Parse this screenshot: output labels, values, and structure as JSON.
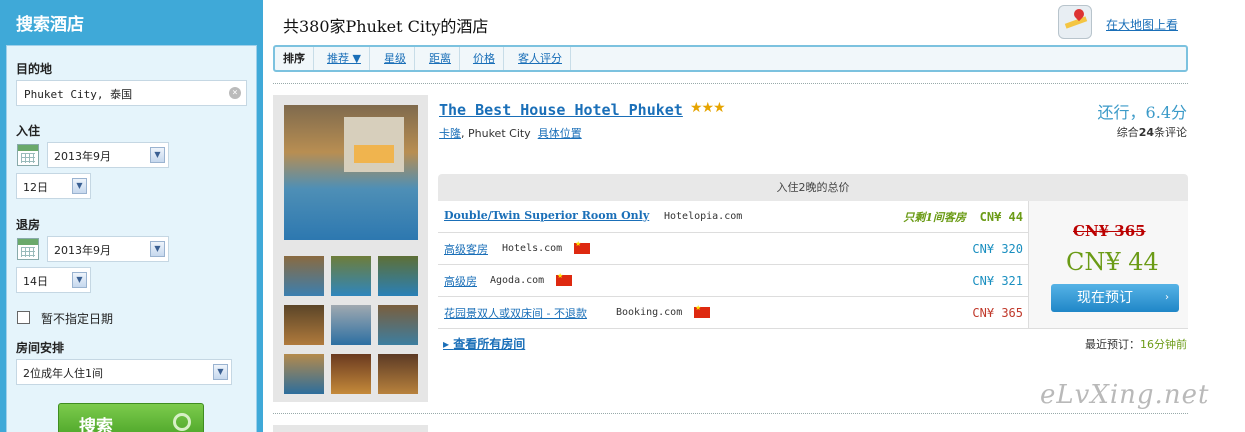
{
  "sidebar": {
    "title": "搜索酒店",
    "destination_label": "目的地",
    "destination_value": "Phuket City, 泰国",
    "checkin_label": "入住",
    "checkin_month": "2013年9月",
    "checkin_day": "12日",
    "checkout_label": "退房",
    "checkout_month": "2013年9月",
    "checkout_day": "14日",
    "no_dates_label": "暂不指定日期",
    "rooms_label": "房间安排",
    "rooms_value": "2位成年人住1间",
    "search_button": "搜索"
  },
  "header": {
    "title": "共380家Phuket City的酒店",
    "map_link": "在大地图上看"
  },
  "sortbar": {
    "label": "排序",
    "items": [
      "推荐 ▼",
      "星级",
      "距离",
      "价格",
      "客人评分"
    ]
  },
  "hotel": {
    "name": "The Best House Hotel Phuket",
    "stars": "★★★",
    "area": "卡隆",
    "city": "Phuket City",
    "location_link": "具体位置",
    "score": "还行，6.4分",
    "reviews_prefix": "综合",
    "reviews_count": "24",
    "reviews_suffix": "条评论",
    "table_header": "入住2晚的总价",
    "rooms": [
      {
        "name": "Double/Twin Superior Room Only",
        "provider": "Hotelopia.com",
        "note": "只剩1间客房",
        "price": "CN¥ 44"
      },
      {
        "name": "高级客房",
        "provider": "Hotels.com",
        "price": "CN¥ 320"
      },
      {
        "name": "高级房",
        "provider": "Agoda.com",
        "price": "CN¥ 321"
      },
      {
        "name": "花园景双人或双床间 - 不退款",
        "provider": "Booking.com",
        "price": "CN¥ 365"
      }
    ],
    "old_price": "CN¥ 365",
    "best_price": "CN¥ 44",
    "book_button": "现在预订",
    "all_rooms_link": "查看所有房间",
    "recent_label": "最近预订：",
    "recent_value": "16分钟前"
  },
  "watermark": "eLvXing.net",
  "colors": {
    "sidebar": "#3fa9d8",
    "link": "#1a6fb8",
    "best_price": "#6b9b16",
    "old_price": "#b00000",
    "book_button": "#1f86c7"
  }
}
